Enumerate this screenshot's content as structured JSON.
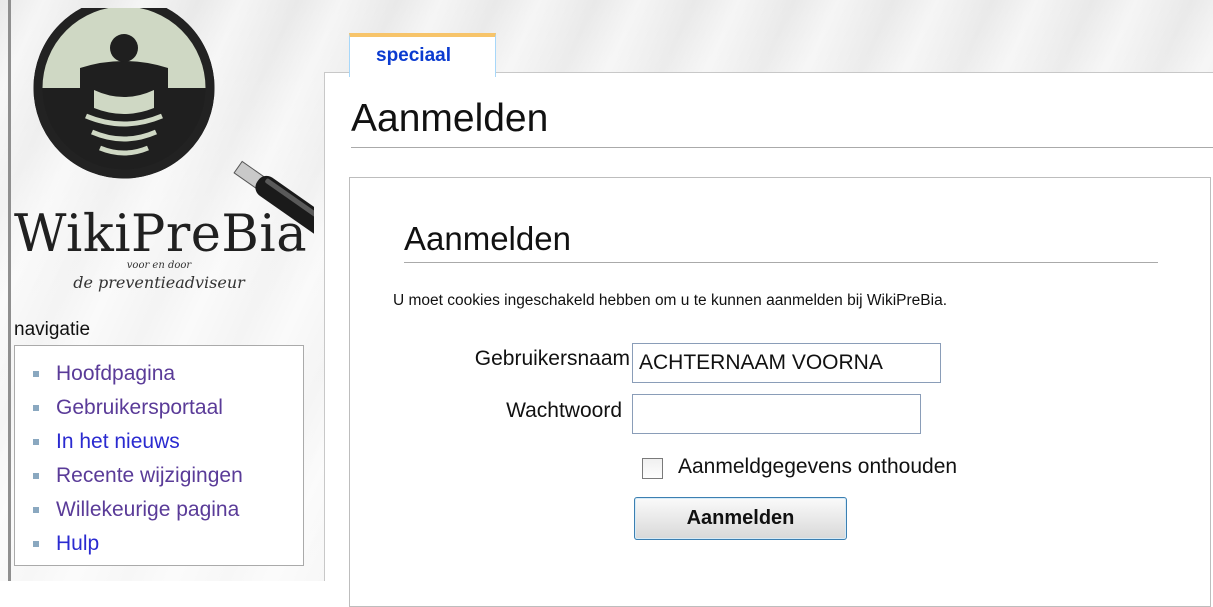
{
  "logo": {
    "wordmark": "WikiPreBia",
    "tagline_small": "voor en door",
    "tagline": "de preventieadviseur"
  },
  "navigation": {
    "heading": "navigatie",
    "items": [
      {
        "label": "Hoofdpagina"
      },
      {
        "label": "Gebruikersportaal"
      },
      {
        "label": "In het nieuws"
      },
      {
        "label": "Recente wijzigingen"
      },
      {
        "label": "Willekeurige pagina"
      },
      {
        "label": "Hulp"
      }
    ]
  },
  "tab": {
    "label": "speciaal"
  },
  "page": {
    "title": "Aanmelden"
  },
  "login": {
    "heading": "Aanmelden",
    "cookie_note": "U moet cookies ingeschakeld hebben om u te kunnen aanmelden bij WikiPreBia.",
    "username_label": "Gebruikersnaam",
    "username_value": "ACHTERNAAM VOORNA",
    "password_label": "Wachtwoord",
    "password_value": "",
    "remember_label": "Aanmeldgegevens onthouden",
    "remember_checked": false,
    "submit_label": "Aanmelden"
  },
  "icons": {
    "logo": "magnifier-logo-icon",
    "bullet": "square-bullet-icon",
    "checkbox": "checkbox-icon"
  },
  "colors": {
    "link": "#5a3b98",
    "link_new": "#2a2ad0",
    "tab_label": "#0b3bd0",
    "tab_accent": "#f7c46a",
    "button_border": "#3c7fb1"
  }
}
